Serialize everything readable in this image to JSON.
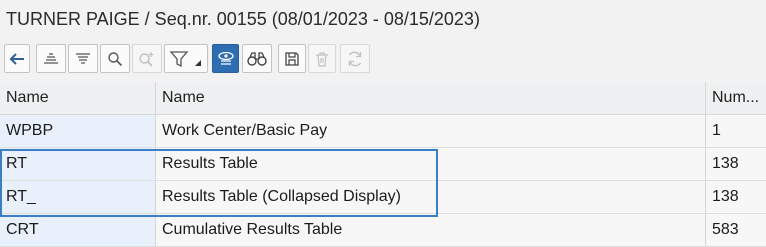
{
  "window": {
    "title": "TURNER PAIGE / Seq.nr. 00155 (08/01/2023 - 08/15/2023)"
  },
  "toolbar": {
    "buttons": [
      {
        "icon": "back-arrow-icon"
      },
      {
        "icon": "sort-ascending-icon"
      },
      {
        "icon": "sort-descending-icon"
      },
      {
        "icon": "search-icon"
      },
      {
        "icon": "search-next-icon",
        "state": "disabled"
      },
      {
        "icon": "filter-dropdown-icon"
      },
      {
        "icon": "display-details-icon",
        "state": "active"
      },
      {
        "icon": "binoculars-icon"
      },
      {
        "icon": "save-icon"
      },
      {
        "icon": "delete-icon",
        "state": "disabled"
      },
      {
        "icon": "refresh-icon",
        "state": "disabled"
      }
    ]
  },
  "table": {
    "columns": [
      "Name",
      "Name",
      "Num..."
    ],
    "rows": [
      {
        "code": "WPBP",
        "name": "Work Center/Basic Pay",
        "num": "1"
      },
      {
        "code": "RT",
        "name": "Results Table",
        "num": "138"
      },
      {
        "code": "RT_",
        "name": "Results Table (Collapsed Display)",
        "num": "138"
      },
      {
        "code": "CRT",
        "name": "Cumulative Results Table",
        "num": "583"
      }
    ]
  },
  "colors": {
    "accent": "#2f6db3",
    "selection_border": "#3a7fc3",
    "code_cell_bg": "#e8f1fb"
  }
}
